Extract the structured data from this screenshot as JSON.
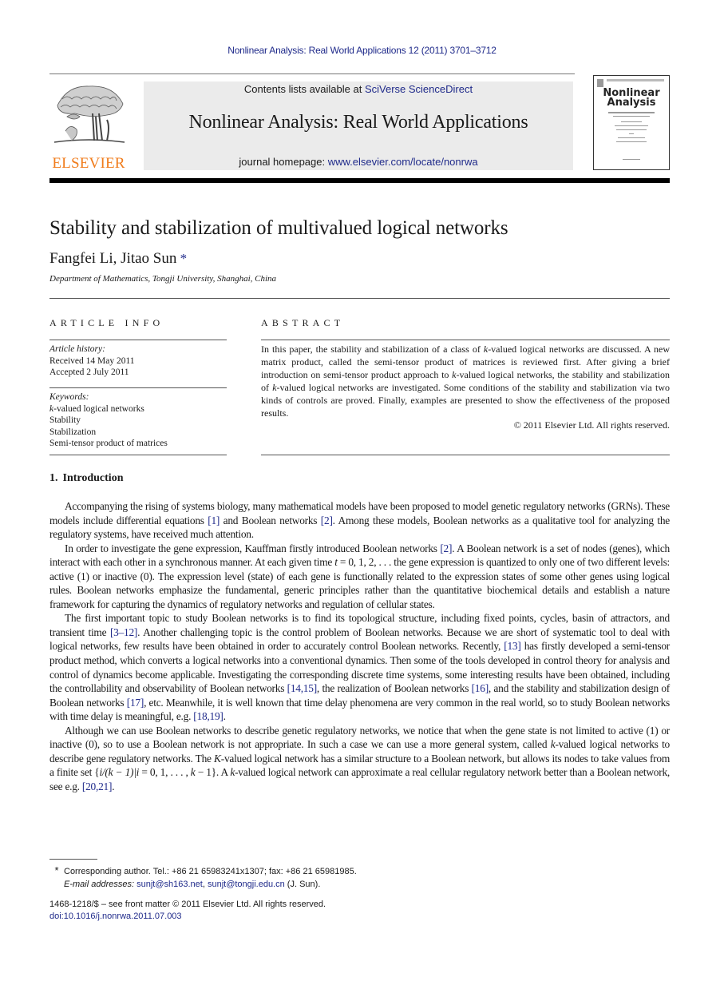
{
  "running_head": "Nonlinear Analysis: Real World Applications 12 (2011) 3701–3712",
  "masthead": {
    "publisher_logo_text": "ELSEVIER",
    "contents_prefix": "Contents lists available at ",
    "contents_link": "SciVerse ScienceDirect",
    "journal_title": "Nonlinear Analysis: Real World Applications",
    "homepage_prefix": "journal homepage: ",
    "homepage_link": "www.elsevier.com/locate/nonrwa",
    "cover_title_line1": "Nonlinear",
    "cover_title_line2": "Analysis"
  },
  "colors": {
    "link": "#1f2a8a",
    "elsevier_orange": "#f07c1c",
    "masthead_bg": "#ebebeb"
  },
  "article": {
    "title": "Stability and stabilization of multivalued logical networks",
    "authors": "Fangfei Li, Jitao Sun",
    "corresponding_mark": "*",
    "affiliation": "Department of Mathematics, Tongji University, Shanghai, China"
  },
  "article_info": {
    "heading": "ARTICLE INFO",
    "history_label": "Article history:",
    "received": "Received 14 May 2011",
    "accepted": "Accepted 2 July 2011",
    "keywords_label": "Keywords:",
    "keywords": [
      {
        "italic_prefix": "k",
        "text": "-valued logical networks"
      },
      {
        "italic_prefix": "",
        "text": "Stability"
      },
      {
        "italic_prefix": "",
        "text": "Stabilization"
      },
      {
        "italic_prefix": "",
        "text": "Semi-tensor product of matrices"
      }
    ]
  },
  "abstract": {
    "heading": "ABSTRACT",
    "segments": [
      "In this paper, the stability and stabilization of a class of ",
      "k",
      "-valued logical networks are discussed. A new matrix product, called the semi-tensor product of matrices is reviewed first. After giving a brief introduction on semi-tensor product approach to ",
      "k",
      "-valued logical networks, the stability and stabilization of ",
      "k",
      "-valued logical networks are investigated. Some conditions of the stability and stabilization via two kinds of controls are proved. Finally, examples are presented to show the effectiveness of the proposed results."
    ],
    "copyright": "© 2011 Elsevier Ltd. All rights reserved."
  },
  "introduction": {
    "number": "1.",
    "title": "Introduction",
    "p1": {
      "a": "Accompanying the rising of systems biology, many mathematical models have been proposed to model genetic regulatory networks (GRNs). These models include differential equations ",
      "c1": "[1]",
      "b": " and Boolean networks ",
      "c2": "[2]",
      "c": ". Among these models, Boolean networks as a qualitative tool for analyzing the regulatory systems, have received much attention."
    },
    "p2": {
      "a": "In order to investigate the gene expression, Kauffman firstly introduced Boolean networks ",
      "c1": "[2]",
      "b": ". A Boolean network is a set of nodes (genes), which interact with each other in a synchronous manner. At each given time ",
      "t": "t",
      "c": " = 0, 1, 2, . . . the gene expression is quantized to only one of two different levels: active (1) or inactive (0). The expression level (state) of each gene is functionally related to the expression states of some other genes using logical rules. Boolean networks emphasize the fundamental, generic principles rather than the quantitative biochemical details and establish a nature framework for capturing the dynamics of regulatory networks and regulation of cellular states."
    },
    "p3": {
      "a": "The first important topic to study Boolean networks is to find its topological structure, including fixed points, cycles, basin of attractors, and transient time ",
      "c1": "[3–12]",
      "b": ". Another challenging topic is the control problem of Boolean networks. Because we are short of systematic tool to deal with logical networks, few results have been obtained in order to accurately control Boolean networks. Recently, ",
      "c2": "[13]",
      "c": " has firstly developed a semi-tensor product method, which converts a logical networks into a conventional dynamics. Then some of the tools developed in control theory for analysis and control of dynamics become applicable. Investigating the corresponding discrete time systems, some interesting results have been obtained, including the controllability and observability of Boolean networks ",
      "c3": "[14,15]",
      "d": ", the realization of Boolean networks ",
      "c4": "[16]",
      "e": ", and the stability and stabilization design of Boolean networks ",
      "c5": "[17]",
      "f": ", etc. Meanwhile, it is well known that time delay phenomena are very common in the real world, so to study Boolean networks with time delay is meaningful, e.g. ",
      "c6": "[18,19]",
      "g": "."
    },
    "p4": {
      "a": "Although we can use Boolean networks to describe genetic regulatory networks, we notice that when the gene state is not limited to active (1) or inactive (0), so to use a Boolean network is not appropriate. In such a case we can use a more general system, called ",
      "k1": "k",
      "b": "-valued logical networks to describe gene regulatory networks. The ",
      "K": "K",
      "c": "-valued logical network has a similar structure to a Boolean network, but allows its nodes to take values from a finite set {",
      "set_math": "i/(k − 1)|i",
      "d": " = 0, 1, . . . , ",
      "k2": "k",
      "e": " − 1}. A ",
      "k3": "k",
      "f": "-valued logical network can approximate a real cellular regulatory network better than a Boolean network, see e.g. ",
      "c1": "[20,21]",
      "g": "."
    }
  },
  "footnote": {
    "star": "*",
    "corresponding": "Corresponding author. Tel.: +86 21 65983241x1307; fax: +86 21 65981985.",
    "email_label": "E-mail addresses: ",
    "email1": "sunjt@sh163.net",
    "sep": ", ",
    "email2": "sunjt@tongji.edu.cn",
    "email_suffix": " (J. Sun)."
  },
  "front_matter": {
    "issn": "1468-1218/$ – see front matter © 2011 Elsevier Ltd. All rights reserved.",
    "doi": "doi:10.1016/j.nonrwa.2011.07.003"
  }
}
